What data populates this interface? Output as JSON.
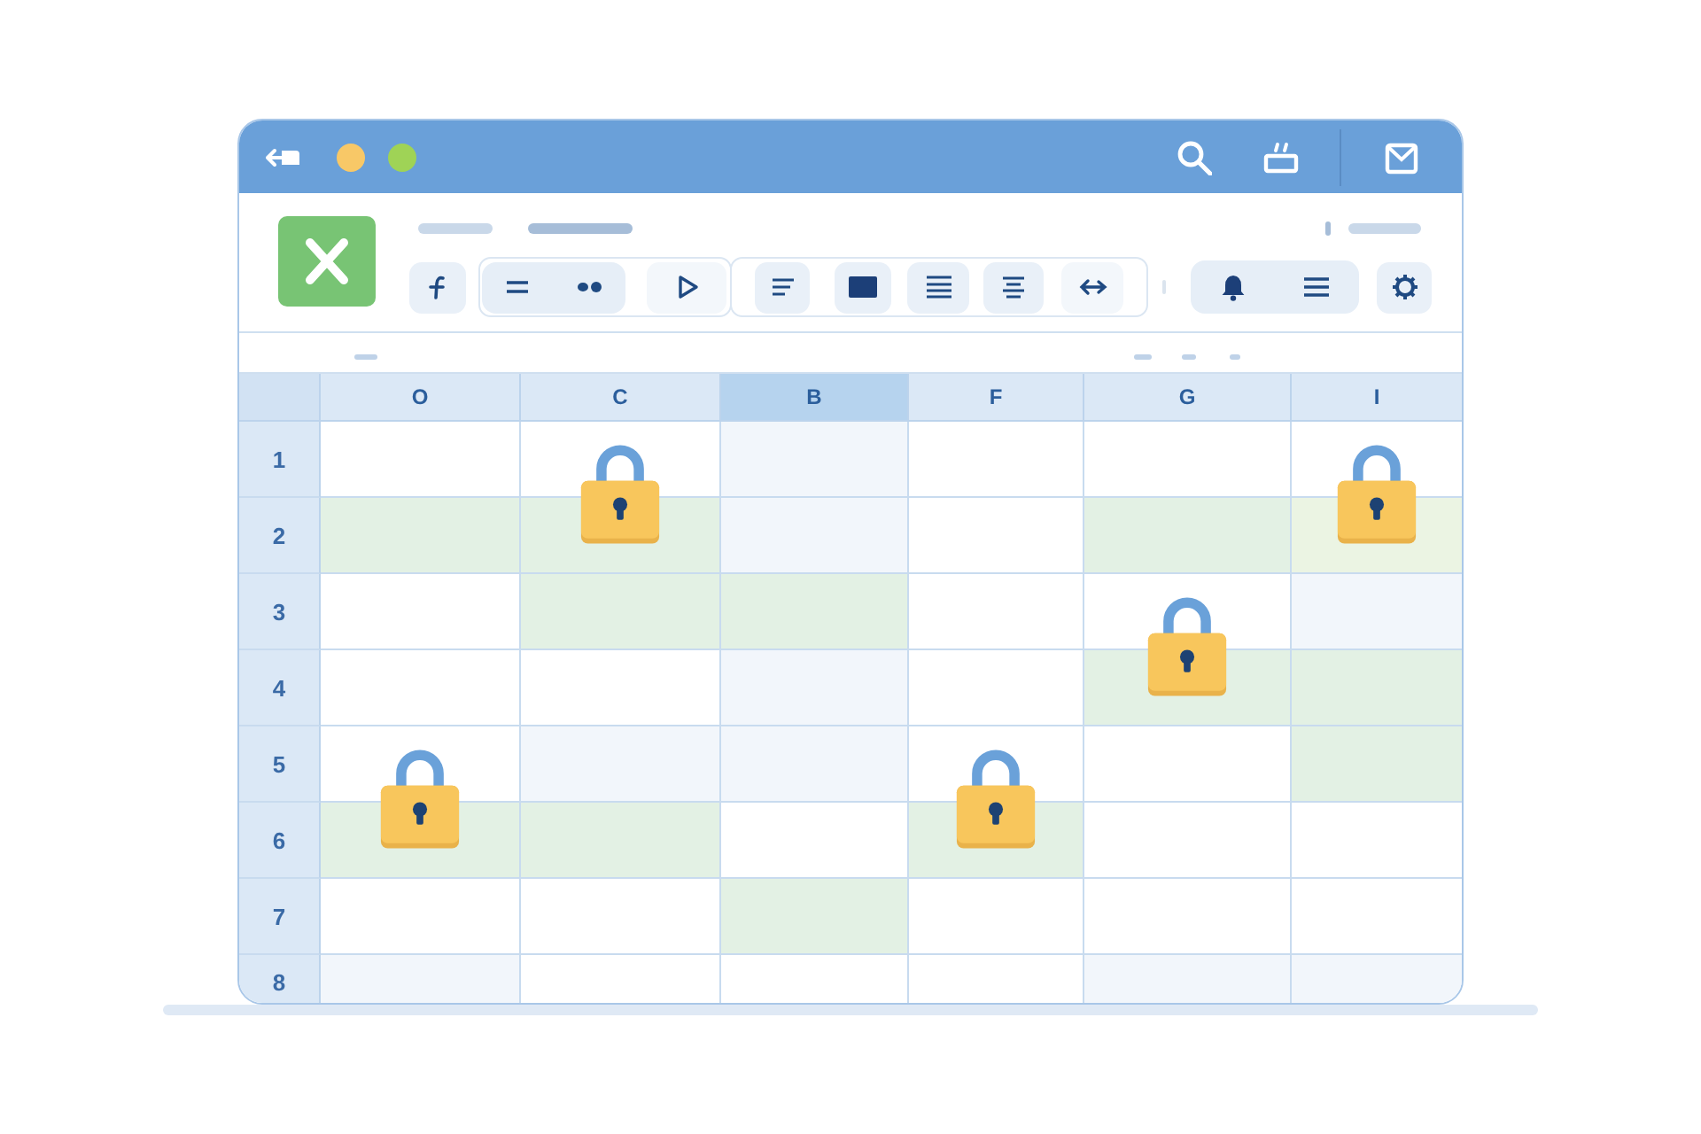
{
  "sheet": {
    "columns": [
      {
        "label": "O",
        "selected": false
      },
      {
        "label": "C",
        "selected": false
      },
      {
        "label": "B",
        "selected": true
      },
      {
        "label": "F",
        "selected": false
      },
      {
        "label": "G",
        "selected": false
      },
      {
        "label": "I",
        "selected": false
      }
    ],
    "rows": [
      {
        "label": "1",
        "cells": [
          {
            "color": "#ffffff",
            "locked": false
          },
          {
            "color": "#ffffff",
            "locked": false
          },
          {
            "color": "#f2f6fb",
            "locked": false
          },
          {
            "color": "#ffffff",
            "locked": false
          },
          {
            "color": "#ffffff",
            "locked": false
          },
          {
            "color": "#ffffff",
            "locked": false
          }
        ]
      },
      {
        "label": "2",
        "cells": [
          {
            "color": "#e3f1e4",
            "locked": false
          },
          {
            "color": "#e3f1e4",
            "locked": true
          },
          {
            "color": "#f2f6fb",
            "locked": false
          },
          {
            "color": "#ffffff",
            "locked": false
          },
          {
            "color": "#e3f1e4",
            "locked": false
          },
          {
            "color": "#ebf4e3",
            "locked": true
          }
        ]
      },
      {
        "label": "3",
        "cells": [
          {
            "color": "#ffffff",
            "locked": false
          },
          {
            "color": "#e3f1e4",
            "locked": false
          },
          {
            "color": "#e3f1e4",
            "locked": false
          },
          {
            "color": "#ffffff",
            "locked": false
          },
          {
            "color": "#ffffff",
            "locked": false
          },
          {
            "color": "#f2f6fb",
            "locked": false
          }
        ]
      },
      {
        "label": "4",
        "cells": [
          {
            "color": "#ffffff",
            "locked": false
          },
          {
            "color": "#ffffff",
            "locked": false
          },
          {
            "color": "#f2f6fb",
            "locked": false
          },
          {
            "color": "#ffffff",
            "locked": false
          },
          {
            "color": "#e3f1e4",
            "locked": true
          },
          {
            "color": "#e3f1e4",
            "locked": false
          }
        ]
      },
      {
        "label": "5",
        "cells": [
          {
            "color": "#ffffff",
            "locked": false
          },
          {
            "color": "#f2f6fb",
            "locked": false
          },
          {
            "color": "#f2f6fb",
            "locked": false
          },
          {
            "color": "#ffffff",
            "locked": false
          },
          {
            "color": "#ffffff",
            "locked": false
          },
          {
            "color": "#e3f1e4",
            "locked": false
          }
        ]
      },
      {
        "label": "6",
        "cells": [
          {
            "color": "#e3f1e4",
            "locked": true
          },
          {
            "color": "#e3f1e4",
            "locked": false
          },
          {
            "color": "#ffffff",
            "locked": false
          },
          {
            "color": "#e3f1e4",
            "locked": true
          },
          {
            "color": "#ffffff",
            "locked": false
          },
          {
            "color": "#ffffff",
            "locked": false
          }
        ]
      },
      {
        "label": "7",
        "cells": [
          {
            "color": "#ffffff",
            "locked": false
          },
          {
            "color": "#ffffff",
            "locked": false
          },
          {
            "color": "#e3f1e4",
            "locked": false
          },
          {
            "color": "#ffffff",
            "locked": false
          },
          {
            "color": "#ffffff",
            "locked": false
          },
          {
            "color": "#ffffff",
            "locked": false
          }
        ]
      },
      {
        "label": "8",
        "cells": [
          {
            "color": "#f2f6fb",
            "locked": false
          },
          {
            "color": "#ffffff",
            "locked": false
          },
          {
            "color": "#ffffff",
            "locked": false
          },
          {
            "color": "#ffffff",
            "locked": false
          },
          {
            "color": "#f2f6fb",
            "locked": false
          },
          {
            "color": "#f2f6fb",
            "locked": false
          }
        ]
      }
    ]
  }
}
